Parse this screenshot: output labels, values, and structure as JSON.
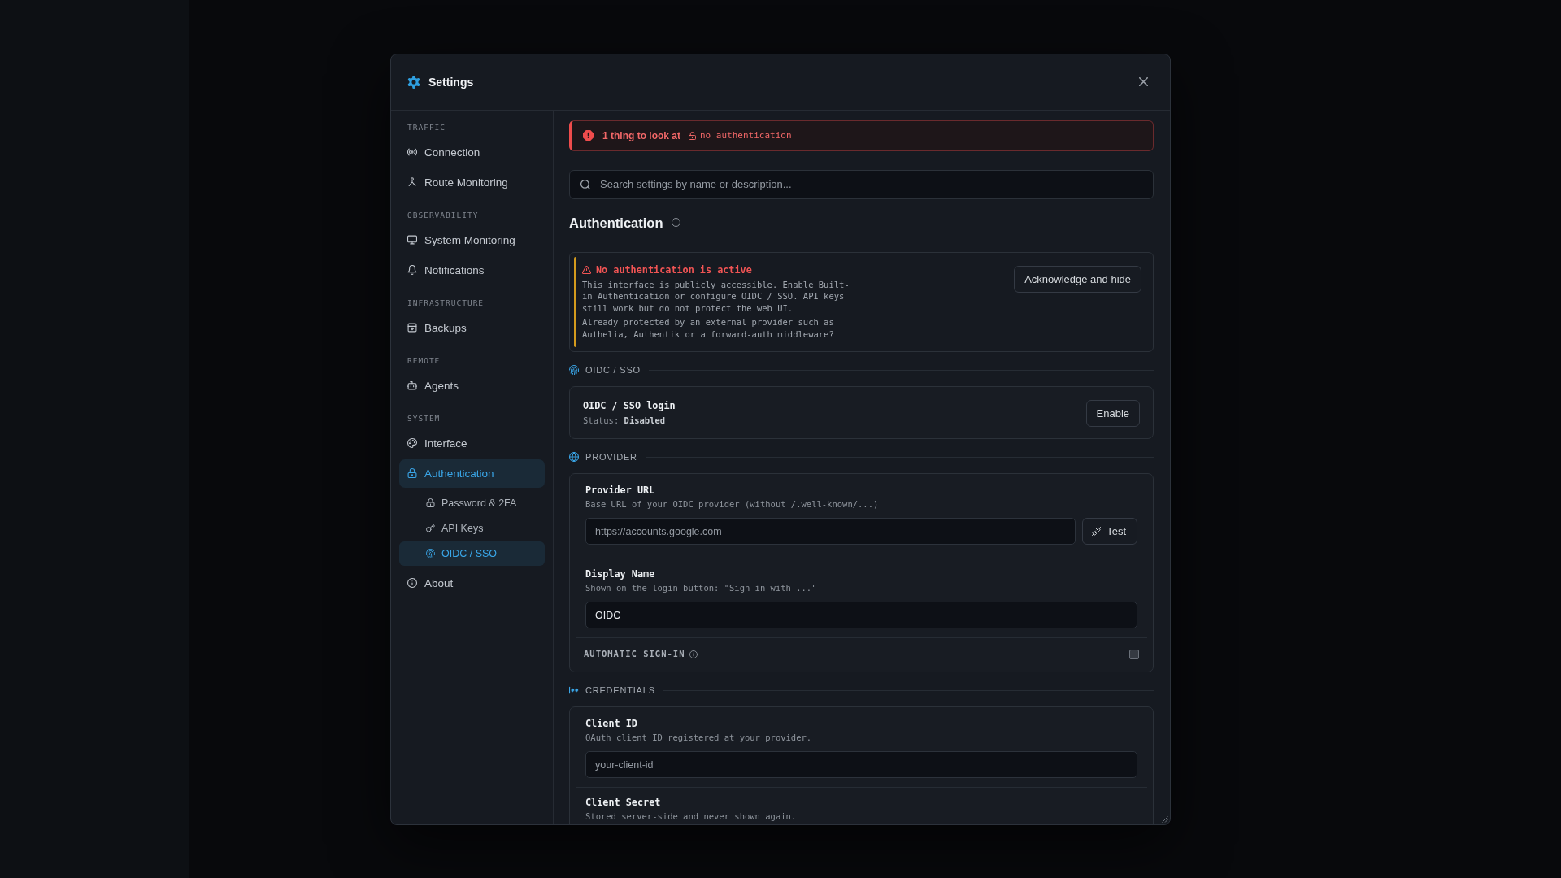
{
  "dialog": {
    "title": "Settings"
  },
  "sidebar": {
    "sections": [
      {
        "heading": "TRAFFIC",
        "items": [
          {
            "label": "Connection",
            "selected": false
          },
          {
            "label": "Route Monitoring",
            "selected": false
          }
        ]
      },
      {
        "heading": "OBSERVABILITY",
        "items": [
          {
            "label": "System Monitoring",
            "selected": false
          },
          {
            "label": "Notifications",
            "selected": false
          }
        ]
      },
      {
        "heading": "INFRASTRUCTURE",
        "items": [
          {
            "label": "Backups",
            "selected": false
          }
        ]
      },
      {
        "heading": "REMOTE",
        "items": [
          {
            "label": "Agents",
            "selected": false
          }
        ]
      },
      {
        "heading": "SYSTEM",
        "items": [
          {
            "label": "Interface",
            "selected": false
          },
          {
            "label": "Authentication",
            "selected": true,
            "children": [
              {
                "label": "Password & 2FA",
                "selected": false
              },
              {
                "label": "API Keys",
                "selected": false
              },
              {
                "label": "OIDC / SSO",
                "selected": true
              }
            ]
          },
          {
            "label": "About",
            "selected": false
          }
        ]
      }
    ]
  },
  "issues_banner": {
    "summary": "1 thing to look at",
    "tag": "no authentication"
  },
  "search": {
    "placeholder": "Search settings by name or description..."
  },
  "page_title": "Authentication",
  "warning": {
    "title": "No authentication is active",
    "text": "This interface is publicly accessible. Enable Built-in Authentication or configure OIDC / SSO. API keys still work but do not protect the web UI.",
    "question": "Already protected by an external provider such as Authelia, Authentik or a forward-auth middleware?",
    "button": "Acknowledge and hide"
  },
  "sections": [
    {
      "heading": "OIDC / SSO",
      "rows": [
        {
          "kind": "status",
          "title": "OIDC / SSO login",
          "status": "Status: **Disabled**",
          "button": "Enable"
        }
      ]
    },
    {
      "heading": "PROVIDER",
      "rows": [
        {
          "kind": "input",
          "label": "Provider URL",
          "description": "Base URL of your OIDC provider (without /.well-known/...)",
          "placeholder": "https://accounts.google.com",
          "button": "Test"
        },
        {
          "kind": "input",
          "label": "Display Name",
          "description": "Shown on the login button: \"Sign in with ...\"",
          "value": "OIDC"
        },
        {
          "kind": "checkbox",
          "label": "AUTOMATIC SIGN-IN",
          "checked": false
        }
      ]
    },
    {
      "heading": "CREDENTIALS",
      "rows": [
        {
          "kind": "input",
          "label": "Client ID",
          "description": "OAuth client ID registered at your provider.",
          "placeholder": "your-client-id"
        },
        {
          "kind": "label",
          "label": "Client Secret",
          "description": "Stored server-side and never shown again."
        }
      ]
    }
  ]
}
